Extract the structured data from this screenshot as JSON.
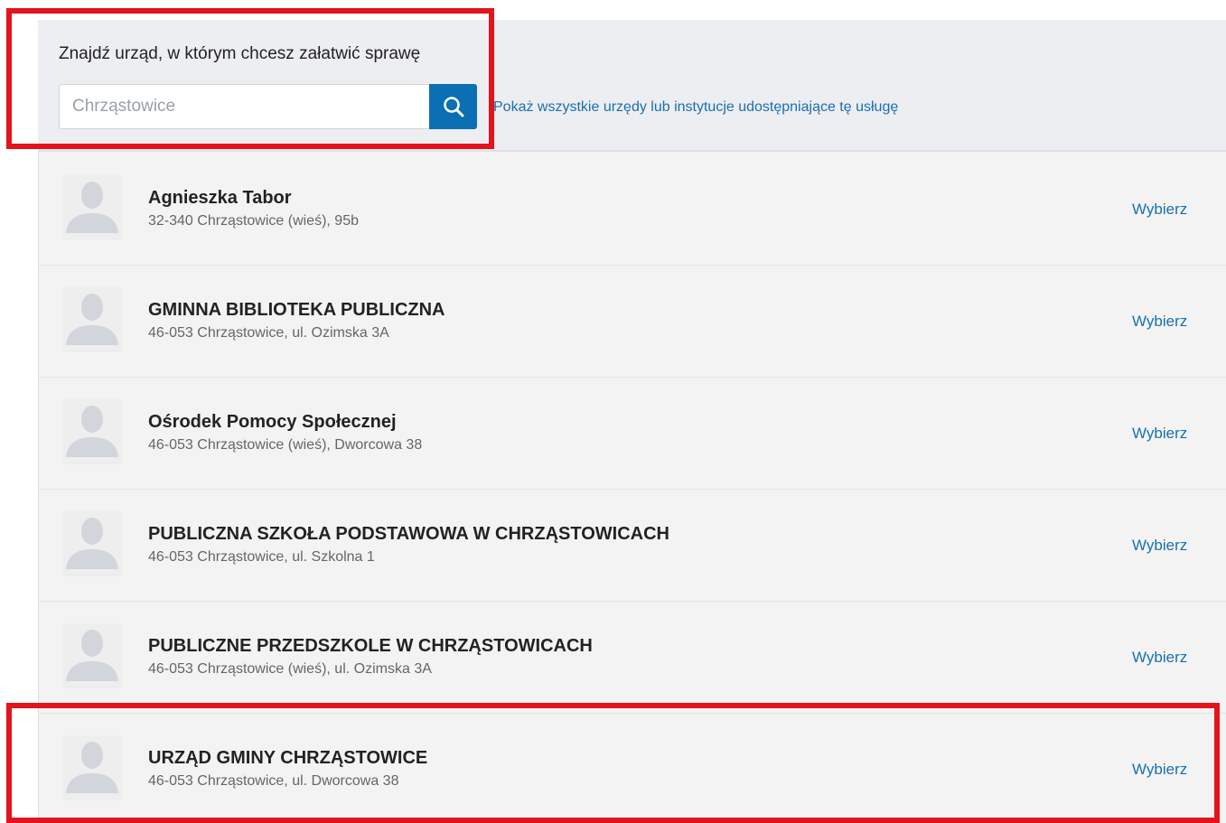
{
  "search": {
    "title": "Znajdź urząd, w którym chcesz załatwić sprawę",
    "placeholder": "Chrząstowice",
    "button_icon": "search-icon",
    "show_all_link": "Pokaż wszystkie urzędy lub instytucje udostępniające tę usługę"
  },
  "results": [
    {
      "name": "Agnieszka Tabor",
      "address": "32-340 Chrząstowice (wieś), 95b",
      "action": "Wybierz"
    },
    {
      "name": "GMINNA BIBLIOTEKA PUBLICZNA",
      "address": "46-053 Chrząstowice, ul. Ozimska 3A",
      "action": "Wybierz"
    },
    {
      "name": "Ośrodek Pomocy Społecznej",
      "address": "46-053 Chrząstowice (wieś), Dworcowa 38",
      "action": "Wybierz"
    },
    {
      "name": "PUBLICZNA SZKOŁA PODSTAWOWA W CHRZĄSTOWICACH",
      "address": "46-053 Chrząstowice, ul. Szkolna 1",
      "action": "Wybierz"
    },
    {
      "name": "PUBLICZNE PRZEDSZKOLE W CHRZĄSTOWICACH",
      "address": "46-053 Chrząstowice (wieś), ul. Ozimska 3A",
      "action": "Wybierz"
    },
    {
      "name": "URZĄD GMINY CHRZĄSTOWICE",
      "address": "46-053 Chrząstowice, ul. Dworcowa 38",
      "action": "Wybierz"
    }
  ],
  "colors": {
    "accent": "#0b6fb3",
    "link": "#1a6fb0",
    "highlight": "#e3141c"
  },
  "icons": {
    "avatar": "person-placeholder-icon"
  }
}
